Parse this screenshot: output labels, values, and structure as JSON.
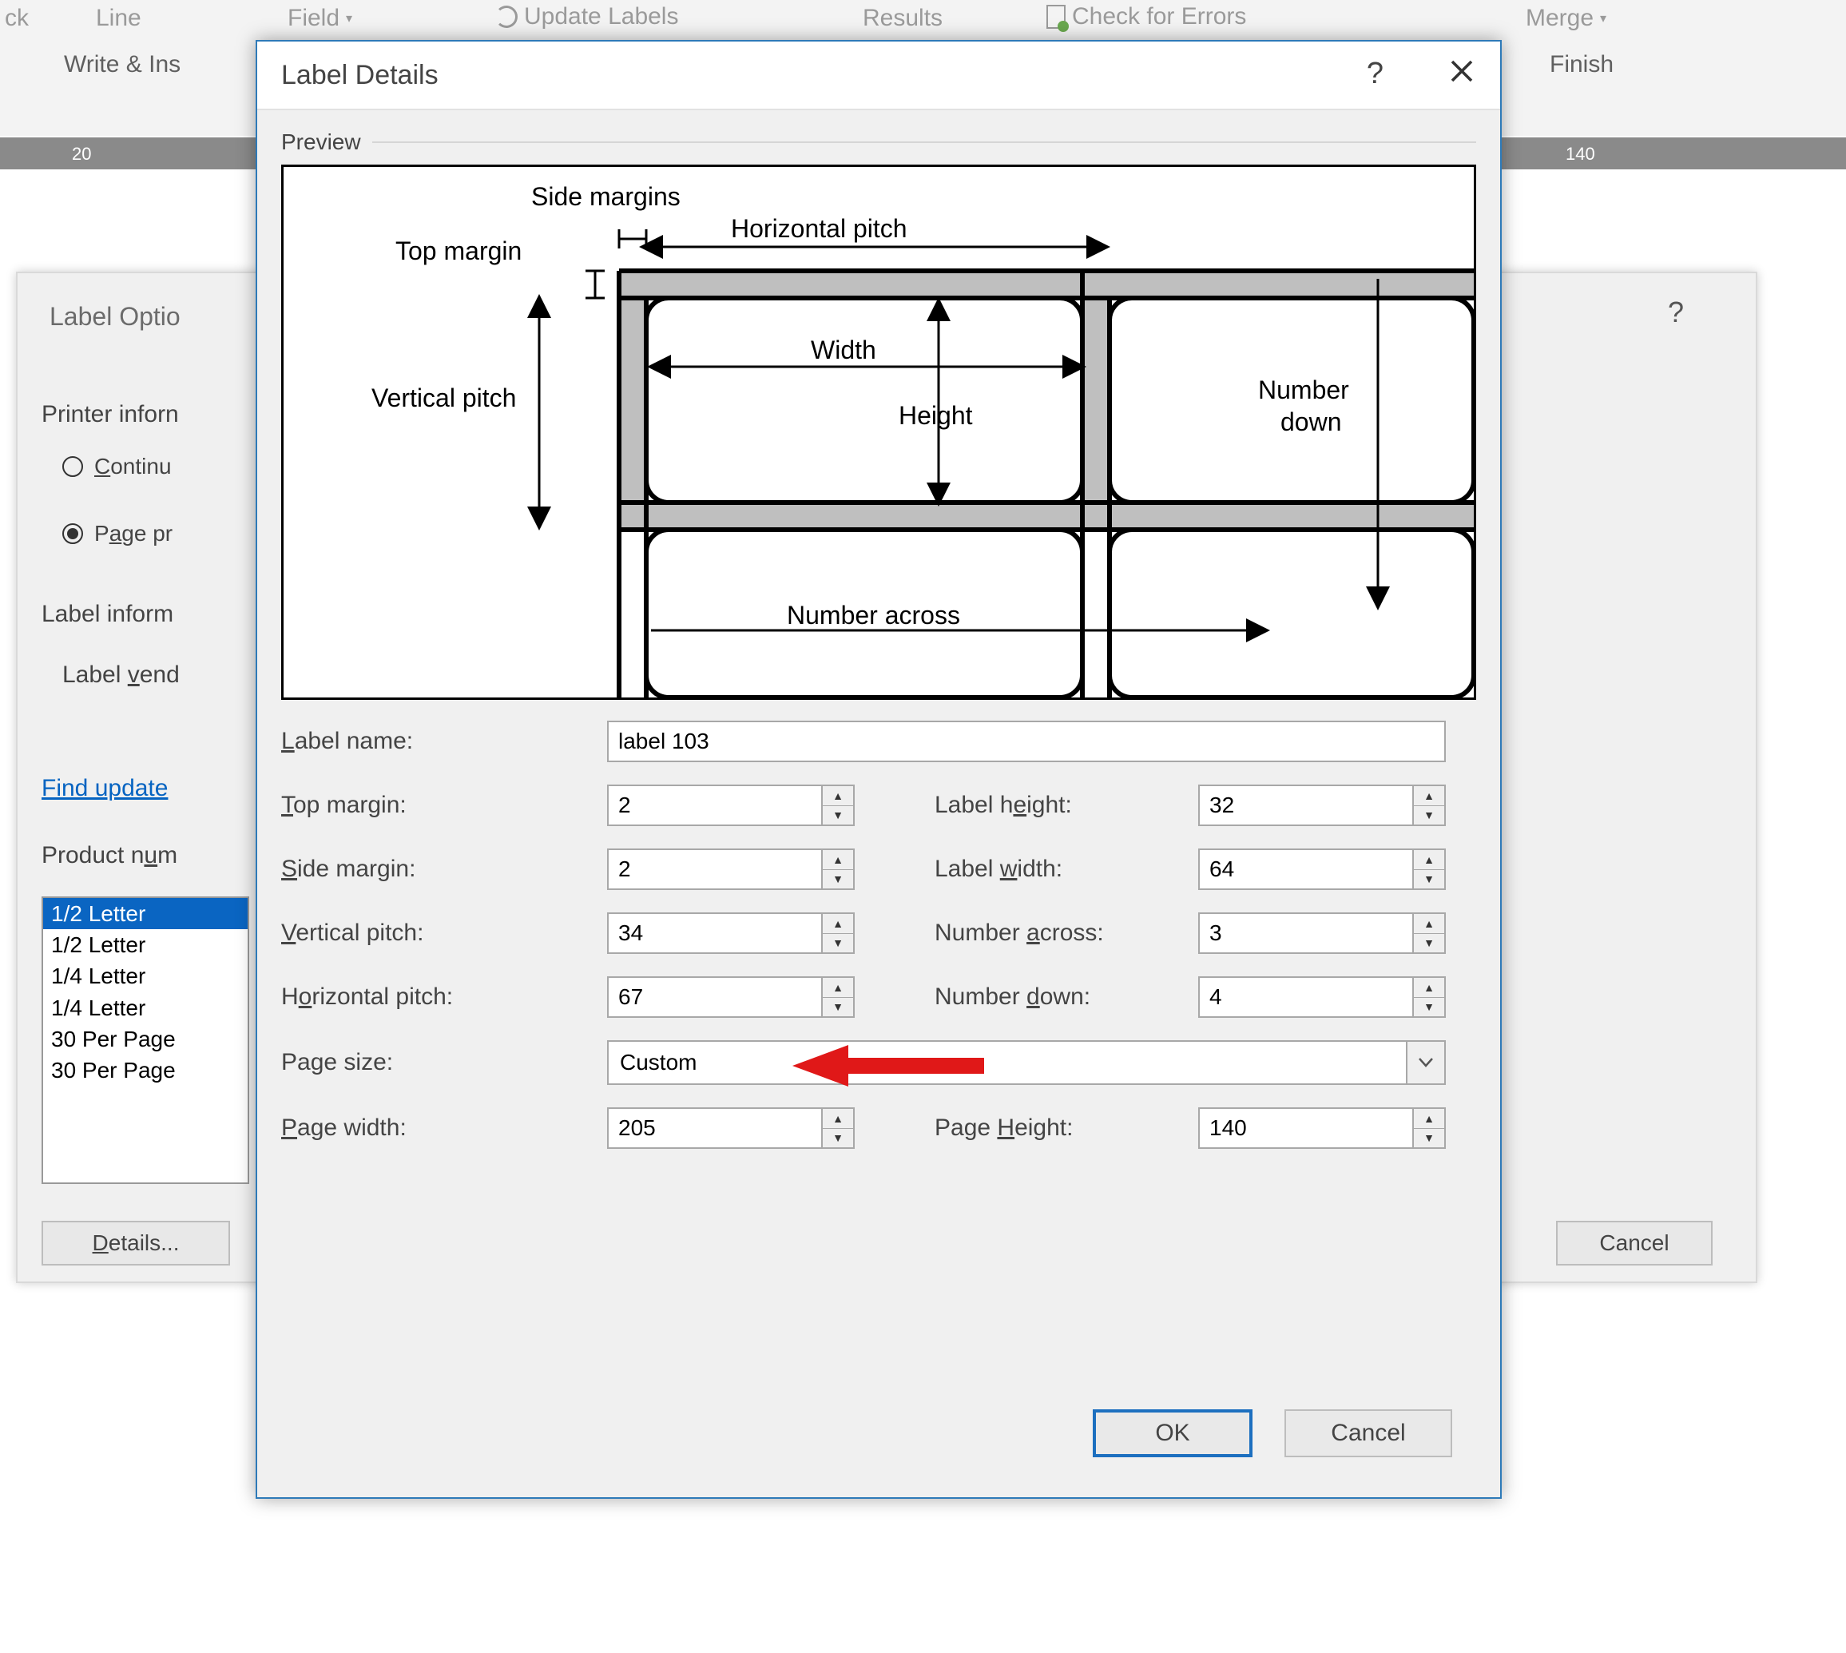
{
  "ribbon": {
    "lineLabel": "Line",
    "fieldLabel": "Field",
    "updateLabels": "Update Labels",
    "resultsLabel": "Results",
    "checkErrors": "Check for Errors",
    "mergeLabel": "Merge",
    "groupWrite": "Write & Ins",
    "groupFinish": "Finish",
    "ckLabel": "ck",
    "rulerLeft": "20",
    "rulerRight": "140"
  },
  "optionsDialog": {
    "title": "Label Optio",
    "printerSection": "Printer inforn",
    "radioContinuous": "Continu",
    "radioPage": "Page pr",
    "labelInfoSection": "Label inform",
    "labelVendors": "Label vend",
    "findUpdates": "Find update",
    "productNumber": "Product num",
    "products": [
      "1/2 Letter",
      "1/2 Letter",
      "1/4 Letter",
      "1/4 Letter",
      "30 Per Page",
      "30 Per Page"
    ],
    "detailsBtn": "Details...",
    "cancelBtn": "Cancel"
  },
  "detailsDialog": {
    "title": "Label Details",
    "previewLabel": "Preview",
    "previewDiagram": {
      "sideMargins": "Side margins",
      "topMargin": "Top margin",
      "horizontalPitch": "Horizontal pitch",
      "verticalPitch": "Vertical pitch",
      "width": "Width",
      "height": "Height",
      "numberDown": "Number down",
      "numberAcross": "Number across"
    },
    "labels": {
      "labelName": "Label name:",
      "topMargin": "Top margin:",
      "sideMargin": "Side margin:",
      "verticalPitch": "Vertical pitch:",
      "horizontalPitch": "Horizontal pitch:",
      "pageSize": "Page size:",
      "pageWidth": "Page width:",
      "labelHeight": "Label height:",
      "labelWidth": "Label width:",
      "numberAcross": "Number across:",
      "numberDown": "Number down:",
      "pageHeight": "Page Height:"
    },
    "values": {
      "labelName": "label 103",
      "topMargin": "2",
      "sideMargin": "2",
      "verticalPitch": "34",
      "horizontalPitch": "67",
      "pageSize": "Custom",
      "pageWidth": "205",
      "labelHeight": "32",
      "labelWidth": "64",
      "numberAcross": "3",
      "numberDown": "4",
      "pageHeight": "140"
    },
    "okBtn": "OK",
    "cancelBtn": "Cancel"
  }
}
